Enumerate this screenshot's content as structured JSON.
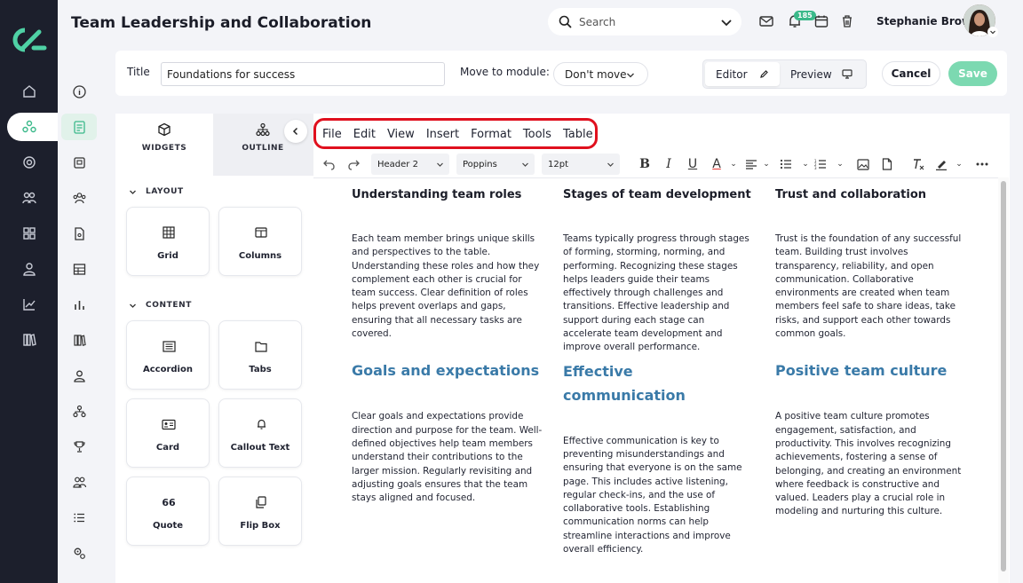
{
  "app": {
    "title": "Team Leadership and Collaboration"
  },
  "search": {
    "placeholder": "Search"
  },
  "notifications": {
    "count": "185"
  },
  "user": {
    "name": "Stephanie Brown"
  },
  "form": {
    "title_label": "Title",
    "title_value": "Foundations for success",
    "move_label": "Move to module:",
    "move_value": "Don't move",
    "editor_tab": "Editor",
    "preview_tab": "Preview",
    "cancel": "Cancel",
    "save": "Save"
  },
  "panel": {
    "tabs": [
      "WIDGETS",
      "OUTLINE"
    ],
    "layout_heading": "LAYOUT",
    "content_heading": "CONTENT",
    "layout_widgets": [
      "Grid",
      "Columns"
    ],
    "content_widgets": [
      "Accordion",
      "Tabs",
      "Card",
      "Callout Text",
      "Quote",
      "Flip Box"
    ],
    "quote_glyph": "66"
  },
  "menu": [
    "File",
    "Edit",
    "View",
    "Insert",
    "Format",
    "Tools",
    "Table"
  ],
  "toolbar": {
    "block": "Header 2",
    "font": "Poppins",
    "size": "12pt"
  },
  "content": {
    "columns": [
      {
        "h1": "Understanding team roles",
        "p1": "Each team member brings unique skills and perspectives to the table. Understanding these roles and how they complement each other is crucial for team success. Clear definition of roles helps prevent overlaps and gaps, ensuring that all necessary tasks are covered.",
        "h2": "Goals and expectations",
        "p2": "Clear goals and expectations provide direction and purpose for the team. Well-defined objectives help team members understand their contributions to the larger mission. Regularly revisiting and adjusting goals ensures that the team stays aligned and focused."
      },
      {
        "h1": "Stages of team development",
        "p1": "Teams typically progress through stages of forming, storming, norming, and performing. Recognizing these stages helps leaders guide their teams effectively through challenges and transitions. Effective leadership and support during each stage can accelerate team development and improve overall performance.",
        "h2": "Effective communication",
        "p2": "Effective communication is key to preventing misunderstandings and ensuring that everyone is on the same page. This includes active listening, regular check-ins, and the use of collaborative tools. Establishing communication norms can help streamline interactions and improve overall efficiency."
      },
      {
        "h1": "Trust and collaboration",
        "p1": "Trust is the foundation of any successful team. Building trust involves transparency, reliability, and open communication. Collaborative environments are created when team members feel safe to share ideas, take risks, and support each other towards common goals.",
        "h2": "Positive team culture",
        "p2": "A positive team culture promotes engagement, satisfaction, and productivity. This involves recognizing achievements, fostering a sense of belonging, and creating an environment where feedback is constructive and valued. Leaders play a crucial role in modeling and nurturing this culture."
      }
    ]
  },
  "colors": {
    "rail": "#1c1f2c",
    "accent": "#3bb98a",
    "save": "#7cd9b1",
    "heading_blue": "#3a7aa8",
    "highlight": "#e0101e"
  }
}
